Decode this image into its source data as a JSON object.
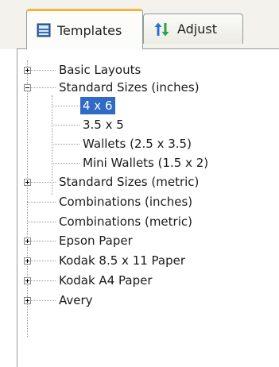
{
  "tabs": [
    {
      "label": "Templates",
      "icon": "templates-icon",
      "active": true
    },
    {
      "label": "Adjust",
      "icon": "adjust-arrows-icon",
      "active": false
    }
  ],
  "tree": [
    {
      "label": "Basic Layouts",
      "level": 0,
      "expander": "plus"
    },
    {
      "label": "Standard Sizes (inches)",
      "level": 0,
      "expander": "minus"
    },
    {
      "label": "4 x 6",
      "level": 1,
      "selected": true
    },
    {
      "label": "3.5 x 5",
      "level": 1
    },
    {
      "label": "Wallets (2.5 x 3.5)",
      "level": 1
    },
    {
      "label": "Mini Wallets (1.5 x 2)",
      "level": 1
    },
    {
      "label": "Standard Sizes (metric)",
      "level": 0,
      "expander": "plus"
    },
    {
      "label": "Combinations (inches)",
      "level": 0
    },
    {
      "label": "Combinations (metric)",
      "level": 0
    },
    {
      "label": "Epson Paper",
      "level": 0,
      "expander": "plus"
    },
    {
      "label": "Kodak 8.5 x 11 Paper",
      "level": 0,
      "expander": "plus"
    },
    {
      "label": "Kodak A4 Paper",
      "level": 0,
      "expander": "plus"
    },
    {
      "label": "Avery",
      "level": 0,
      "expander": "plus"
    }
  ],
  "colors": {
    "selection": "#316ac5",
    "active_tab_accent": "#f5b43a",
    "tab_border": "#919b9c"
  }
}
